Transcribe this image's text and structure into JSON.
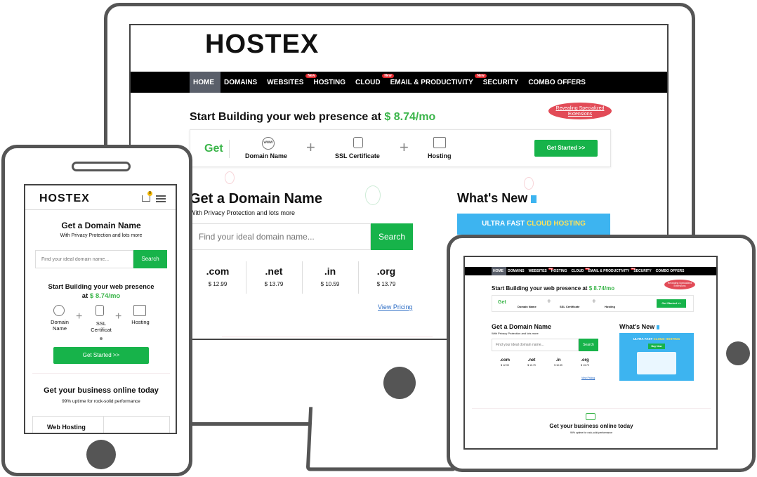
{
  "brand": {
    "logo": "HOSTEX"
  },
  "desktop": {
    "nav": [
      {
        "label": "HOME",
        "badge": ""
      },
      {
        "label": "DOMAINS",
        "badge": ""
      },
      {
        "label": "WEBSITES",
        "badge": "New"
      },
      {
        "label": "HOSTING",
        "badge": ""
      },
      {
        "label": "CLOUD",
        "badge": "New"
      },
      {
        "label": "EMAIL & PRODUCTIVITY",
        "badge": "New"
      },
      {
        "label": "SECURITY",
        "badge": ""
      },
      {
        "label": "COMBO OFFERS",
        "badge": ""
      }
    ],
    "promo_text": "Start Building your web presence at ",
    "promo_price": "$ 8.74/mo",
    "ribbon": "Revealing Specialized Extensions",
    "get_label": "Get",
    "get_items": [
      "Domain Name",
      "SSL Certificate",
      "Hosting"
    ],
    "get_started": "Get Started >>",
    "domain_title": "Get a Domain Name",
    "domain_subtitle": "With Privacy Protection and lots more",
    "search_placeholder": "Find your ideal domain name...",
    "search_button": "Search",
    "tlds": [
      {
        "name": ".com",
        "price": "$ 12.99"
      },
      {
        "name": ".net",
        "price": "$ 13.79"
      },
      {
        "name": ".in",
        "price": "$ 10.59"
      },
      {
        "name": ".org",
        "price": "$ 13.79"
      }
    ],
    "view_pricing": "View Pricing",
    "whats_new": "What's New",
    "banner_text": "ULTRA FAST ",
    "banner_highlight": "CLOUD HOSTING"
  },
  "mobile": {
    "domain_title": "Get a Domain Name",
    "domain_subtitle": "With Privacy Protection and lots more",
    "search_placeholder": "Find your ideal domain name...",
    "search_button": "Search",
    "promo_line1": "Start Building your web presence",
    "promo_at": "at ",
    "promo_price": "$ 8.74/mo",
    "items": [
      "Domain Name",
      "SSL Certificat",
      "Hosting"
    ],
    "get_started": "Get Started >>",
    "business_title": "Get your business online today",
    "business_subtitle": "99% uptime for rock-solid performance",
    "web_hosting": "Web Hosting",
    "cart_count": "0"
  },
  "tablet": {
    "nav": [
      {
        "label": "HOME",
        "badge": ""
      },
      {
        "label": "DOMAINS",
        "badge": ""
      },
      {
        "label": "WEBSITES",
        "badge": "New"
      },
      {
        "label": "HOSTING",
        "badge": ""
      },
      {
        "label": "CLOUD",
        "badge": "New"
      },
      {
        "label": "EMAIL & PRODUCTIVITY",
        "badge": "New"
      },
      {
        "label": "SECURITY",
        "badge": ""
      },
      {
        "label": "COMBO OFFERS",
        "badge": ""
      }
    ],
    "promo_text": "Start Building your web presence at ",
    "promo_price": "$ 8.74/mo",
    "ribbon": "Revealing Specialized Extensions",
    "get_label": "Get",
    "get_items": [
      "Domain Name",
      "SSL Certificate",
      "Hosting"
    ],
    "get_started": "Get Started >>",
    "domain_title": "Get a Domain Name",
    "domain_subtitle": "With Privacy Protection and lots more",
    "search_placeholder": "Find your ideal domain name...",
    "search_button": "Search",
    "tlds": [
      {
        "name": ".com",
        "price": "$ 12.99"
      },
      {
        "name": ".net",
        "price": "$ 13.79"
      },
      {
        "name": ".in",
        "price": "$ 10.59"
      },
      {
        "name": ".org",
        "price": "$ 13.79"
      }
    ],
    "view_pricing": "View Pricing",
    "whats_new": "What's New",
    "banner_text": "ULTRA FAST ",
    "banner_highlight": "CLOUD HOSTING",
    "buy_now": "Buy Now",
    "business_title": "Get your business online today",
    "business_subtitle": "99% uptime for rock-solid performance"
  },
  "colors": {
    "accent": "#3bb54a",
    "button": "#17b34a",
    "nav": "#000000",
    "badge": "#e0282e",
    "banner": "#3db4f0",
    "ribbon": "#e24b57"
  }
}
